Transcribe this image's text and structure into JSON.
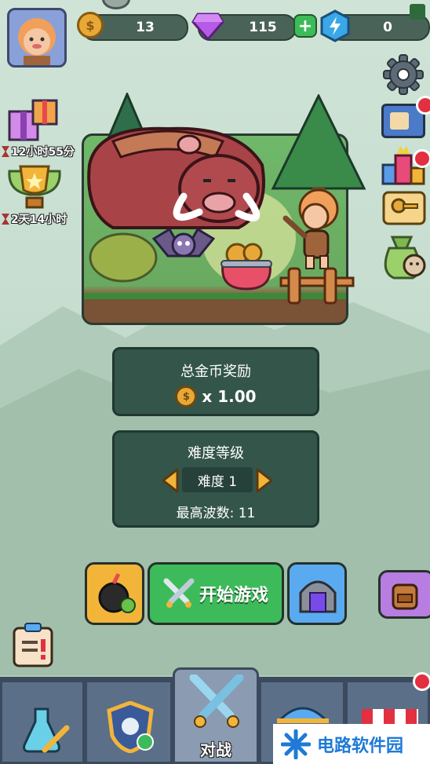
{
  "currency": {
    "coins": "13",
    "gems": "115",
    "energy": "0"
  },
  "timers": {
    "gift_timer": "12小时55分",
    "trophy_timer": "2天14小时"
  },
  "reward": {
    "title": "总金币奖励",
    "multiplier": "x 1.00"
  },
  "difficulty": {
    "title": "难度等级",
    "level": "难度 1",
    "max_wave": "最高波数: 11"
  },
  "actions": {
    "start_game": "开始游戏"
  },
  "bottom_nav": {
    "battle": "对战"
  },
  "watermark": {
    "text": "电路软件园"
  },
  "colors": {
    "accent_green": "#3dbb5a",
    "coin_gold": "#e8a838",
    "gem_purple": "#a64ce0",
    "energy_blue": "#3aa8e8",
    "panel": "#34554a"
  }
}
